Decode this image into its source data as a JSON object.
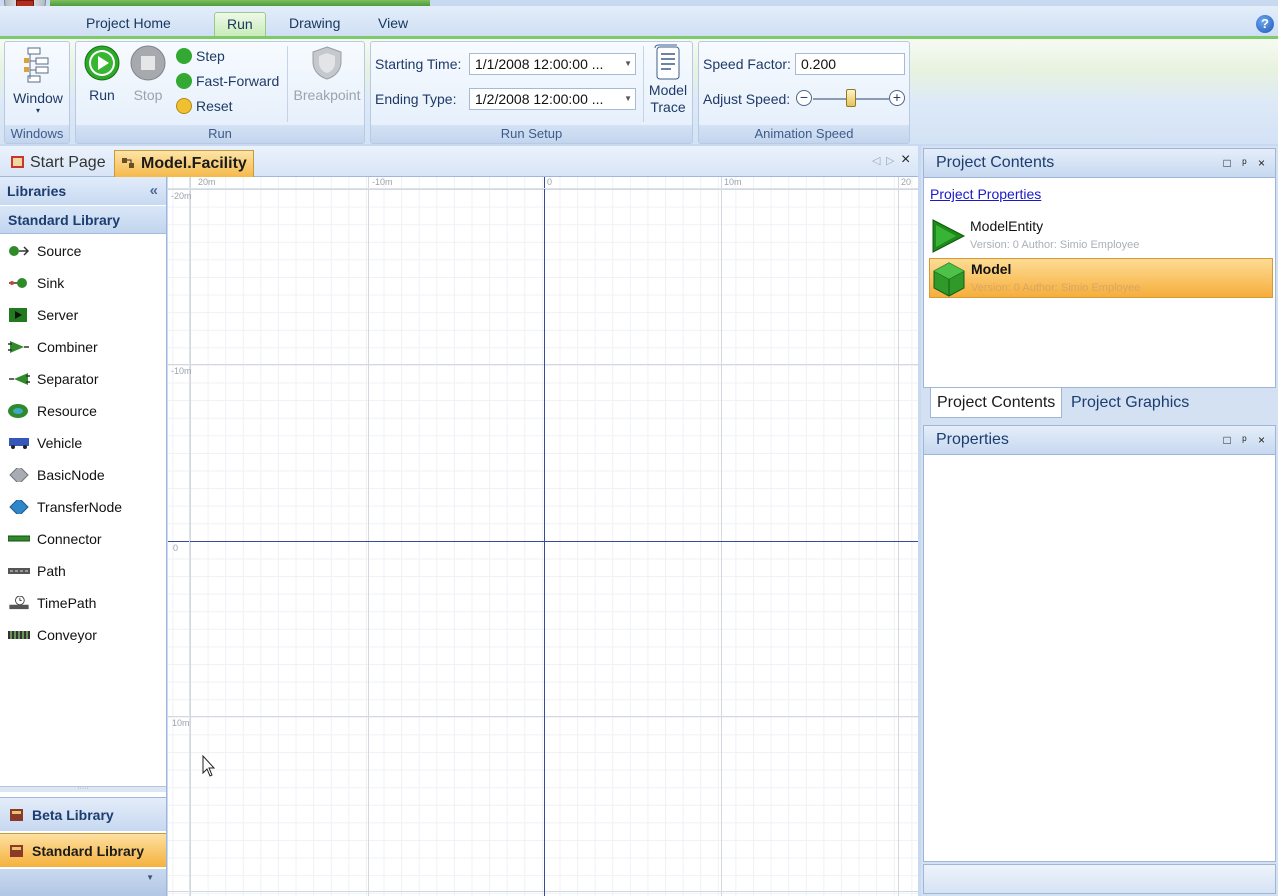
{
  "ribbon": {
    "tabs": [
      {
        "label": "Project Home",
        "active": false
      },
      {
        "label": "Run",
        "active": true
      },
      {
        "label": "Drawing",
        "active": false
      },
      {
        "label": "View",
        "active": false
      }
    ],
    "help_icon": "question-icon",
    "groups": {
      "windows": {
        "label": "Windows",
        "window_button": "Window"
      },
      "run": {
        "label": "Run",
        "run_button": "Run",
        "stop_button": "Stop",
        "step_button": "Step",
        "fast_forward_button": "Fast-Forward",
        "reset_button": "Reset",
        "breakpoint_button": "Breakpoint"
      },
      "run_setup": {
        "label": "Run Setup",
        "starting_time_label": "Starting Time:",
        "starting_time_value": "1/1/2008 12:00:00 ...",
        "ending_type_label": "Ending Type:",
        "ending_type_value": "1/2/2008 12:00:00 ...",
        "model_trace_line1": "Model",
        "model_trace_line2": "Trace"
      },
      "animation_speed": {
        "label": "Animation Speed",
        "speed_factor_label": "Speed Factor:",
        "speed_factor_value": "0.200",
        "adjust_speed_label": "Adjust Speed:",
        "slider_position": 0.5
      }
    }
  },
  "document_tabs": [
    {
      "label": "Start Page",
      "active": false
    },
    {
      "label": "Model.Facility",
      "active": true
    }
  ],
  "libraries": {
    "header": "Libraries",
    "collapse_glyph": "«",
    "section": "Standard Library",
    "items": [
      {
        "label": "Source",
        "icon": "source-icon"
      },
      {
        "label": "Sink",
        "icon": "sink-icon"
      },
      {
        "label": "Server",
        "icon": "server-icon"
      },
      {
        "label": "Combiner",
        "icon": "combiner-icon"
      },
      {
        "label": "Separator",
        "icon": "separator-icon"
      },
      {
        "label": "Resource",
        "icon": "resource-icon"
      },
      {
        "label": "Vehicle",
        "icon": "vehicle-icon"
      },
      {
        "label": "BasicNode",
        "icon": "basic-node-icon"
      },
      {
        "label": "TransferNode",
        "icon": "transfer-node-icon"
      },
      {
        "label": "Connector",
        "icon": "connector-icon"
      },
      {
        "label": "Path",
        "icon": "path-icon"
      },
      {
        "label": "TimePath",
        "icon": "time-path-icon"
      },
      {
        "label": "Conveyor",
        "icon": "conveyor-icon"
      }
    ],
    "bottom_tabs": [
      {
        "label": "Beta Library",
        "active": false
      },
      {
        "label": "Standard Library",
        "active": true
      }
    ]
  },
  "canvas": {
    "top_ruler": [
      "20m",
      "-10m",
      "0",
      "10m",
      "20"
    ],
    "left_ruler": [
      "-20m",
      "-10m",
      "0",
      "10m"
    ]
  },
  "project_contents": {
    "title": "Project Contents",
    "pane_buttons": "□ ᵖ ×",
    "properties_link": "Project Properties",
    "items": [
      {
        "name": "ModelEntity",
        "meta": "Version: 0 Author: Simio Employee",
        "selected": false
      },
      {
        "name": "Model",
        "meta": "Version: 0 Author: Simio Employee",
        "selected": true
      }
    ],
    "tabs": [
      {
        "label": "Project Contents",
        "active": true
      },
      {
        "label": "Project Graphics",
        "active": false
      }
    ]
  },
  "properties": {
    "title": "Properties",
    "pane_buttons": "□ ᵖ ×"
  },
  "colors": {
    "ribbon_accent": "#7ec96a",
    "selection_orange": "#f6ae3c",
    "axis_blue": "#3a4a9a"
  }
}
